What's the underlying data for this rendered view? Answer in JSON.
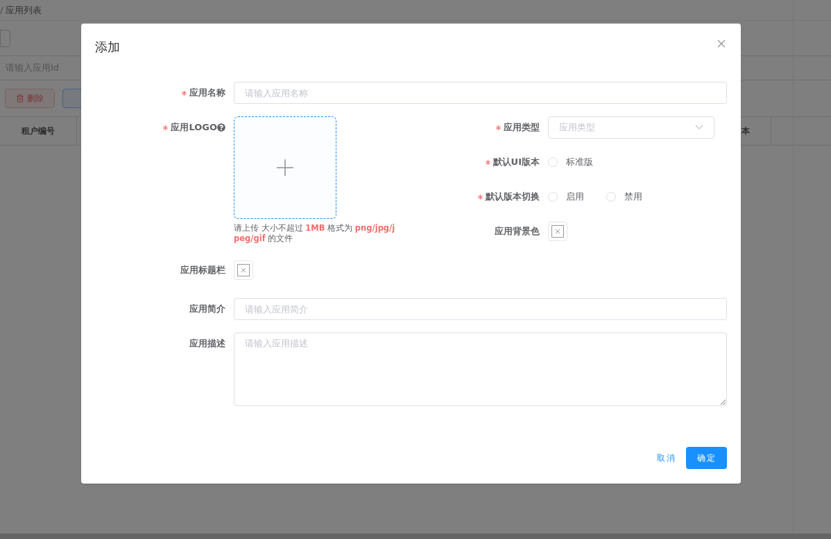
{
  "background": {
    "breadcrumb_separator": "/",
    "breadcrumb": "应用列表",
    "search": {
      "placeholder": "请输入应用Id"
    },
    "delete_button": "删除",
    "table": {
      "columns": [
        "租户编号",
        "本"
      ]
    }
  },
  "dialog": {
    "title": "添加",
    "name": {
      "label": "应用名称",
      "required": true,
      "placeholder": "请输入应用名称"
    },
    "logo": {
      "label": "应用LOGO",
      "required": true,
      "hint": "请上传 大小不超过 **1MB** 格式为 **png/jpg/jpeg/gif** 的文件"
    },
    "app_type": {
      "label": "应用类型",
      "required": true,
      "placeholder": "应用类型"
    },
    "ui_version": {
      "label": "默认UI版本",
      "required": true,
      "options": [
        {
          "label": "标准版",
          "selected": false
        }
      ]
    },
    "version_switch": {
      "label": "默认版本切换",
      "required": true,
      "options": [
        {
          "label": "启用",
          "selected": false
        },
        {
          "label": "禁用",
          "selected": false
        }
      ]
    },
    "background_color": {
      "label": "应用背景色",
      "required": false
    },
    "titlebar_color": {
      "label": "应用标题栏",
      "required": false
    },
    "summary": {
      "label": "应用简介",
      "required": false,
      "placeholder": "请输入应用简介"
    },
    "description": {
      "label": "应用描述",
      "required": false,
      "placeholder": "请输入应用描述"
    },
    "buttons": {
      "cancel": "取消",
      "confirm": "确定"
    }
  }
}
